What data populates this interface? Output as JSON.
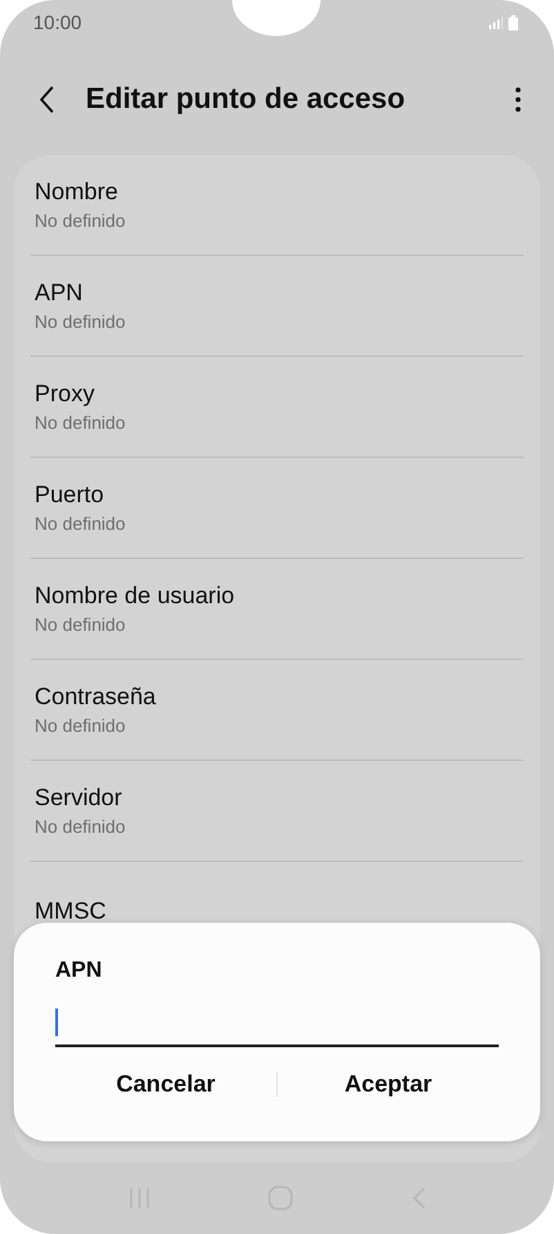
{
  "status_bar": {
    "time": "10:00"
  },
  "header": {
    "title": "Editar punto de acceso"
  },
  "settings": [
    {
      "title": "Nombre",
      "value": "No definido"
    },
    {
      "title": "APN",
      "value": "No definido"
    },
    {
      "title": "Proxy",
      "value": "No definido"
    },
    {
      "title": "Puerto",
      "value": "No definido"
    },
    {
      "title": "Nombre de usuario",
      "value": "No definido"
    },
    {
      "title": "Contraseña",
      "value": "No definido"
    },
    {
      "title": "Servidor",
      "value": "No definido"
    },
    {
      "title": "MMSC"
    }
  ],
  "dialog": {
    "title": "APN",
    "buttons": [
      "Cancelar",
      "Aceptar"
    ]
  }
}
